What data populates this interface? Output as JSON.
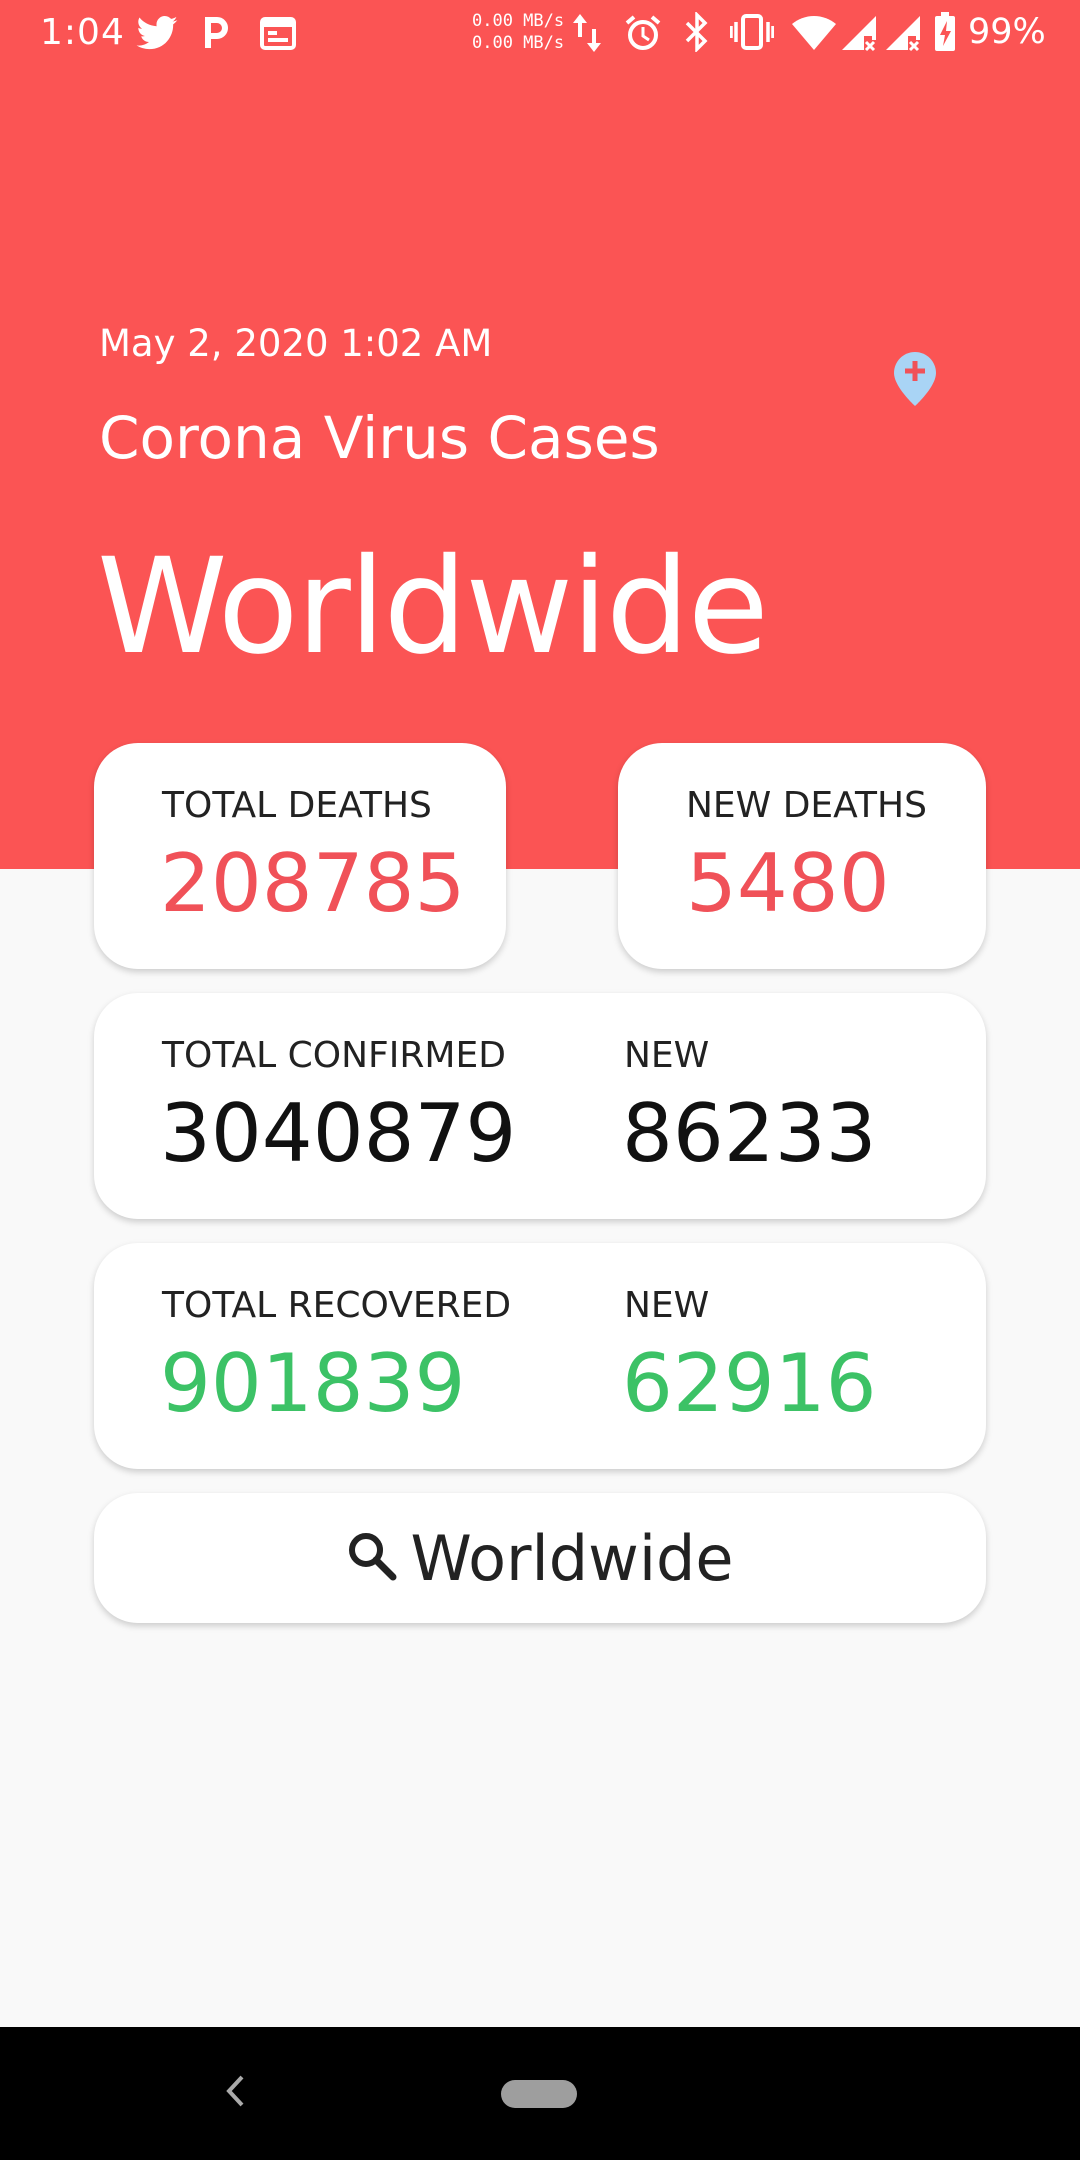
{
  "status_bar": {
    "time": "1:04",
    "net_up": "0.00 MB/s",
    "net_down": "0.00 MB/s",
    "battery": "99%",
    "icons": [
      "twitter-icon",
      "p-icon",
      "calendar-icon",
      "data-arrows-icon",
      "alarm-icon",
      "bluetooth-icon",
      "vibrate-icon",
      "wifi-icon",
      "signal-icon",
      "signal-icon",
      "battery-charging-icon"
    ]
  },
  "header": {
    "date": "May 2, 2020 1:02 AM",
    "subtitle": "Corona Virus Cases",
    "region": "Worldwide",
    "location_icon": "map-pin-plus-icon"
  },
  "stats": {
    "total_deaths": {
      "label": "TOTAL DEATHS",
      "value": "208785"
    },
    "new_deaths": {
      "label": "NEW DEATHS",
      "value": "5480"
    },
    "confirmed": {
      "label": "TOTAL CONFIRMED",
      "value": "3040879",
      "new_label": "NEW",
      "new_value": "86233"
    },
    "recovered": {
      "label": "TOTAL RECOVERED",
      "value": "901839",
      "new_label": "NEW",
      "new_value": "62916"
    }
  },
  "search": {
    "label": "Worldwide",
    "icon": "search-icon"
  },
  "colors": {
    "accent": "#fb5454",
    "deaths": "#f05158",
    "recovered": "#3cc266",
    "pin": "#a9d4f5"
  }
}
